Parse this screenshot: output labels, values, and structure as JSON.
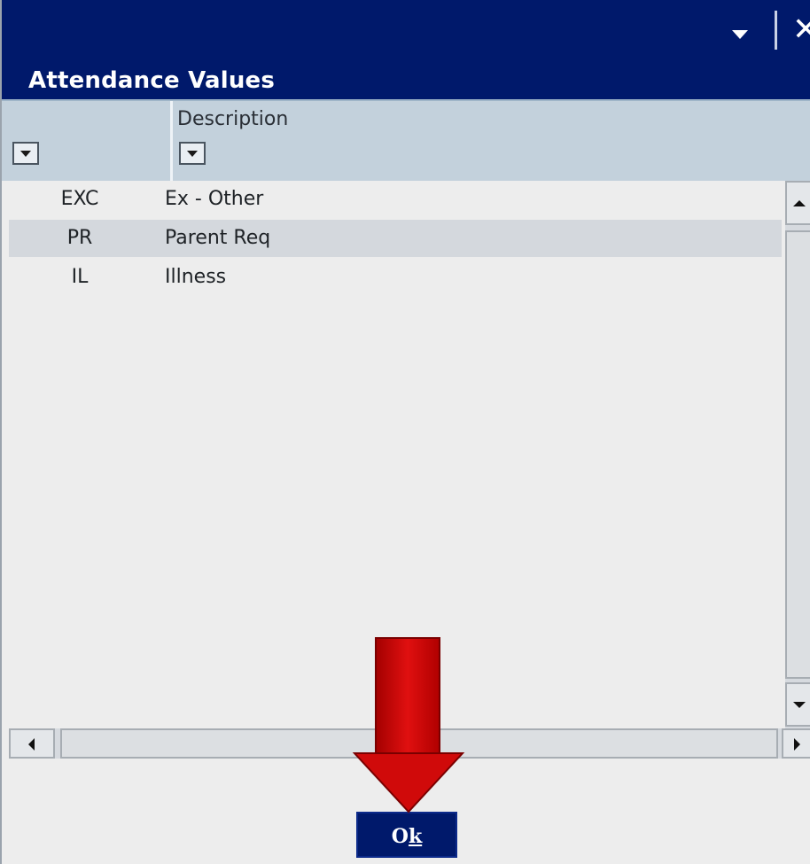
{
  "dialog": {
    "title": "Attendance Values",
    "titlebar_buttons": {
      "dropdown_icon": "chevron-down-icon",
      "close_icon": "close-icon",
      "close_glyph": "✕"
    }
  },
  "grid": {
    "columns": {
      "code_header": "",
      "description_header": "Description"
    },
    "rows": [
      {
        "code": "EXC",
        "description": "Ex - Other",
        "selected": false
      },
      {
        "code": "PR",
        "description": "Parent Req",
        "selected": true
      },
      {
        "code": "IL",
        "description": "Illness",
        "selected": false
      }
    ]
  },
  "footer": {
    "ok_label_prefix": "O",
    "ok_label_mnemonic": "k"
  },
  "colors": {
    "titlebar": "#00196b",
    "header": "#c3d1dc",
    "selected_row": "#d4d8dd",
    "annotation_arrow": "#cc0000"
  }
}
